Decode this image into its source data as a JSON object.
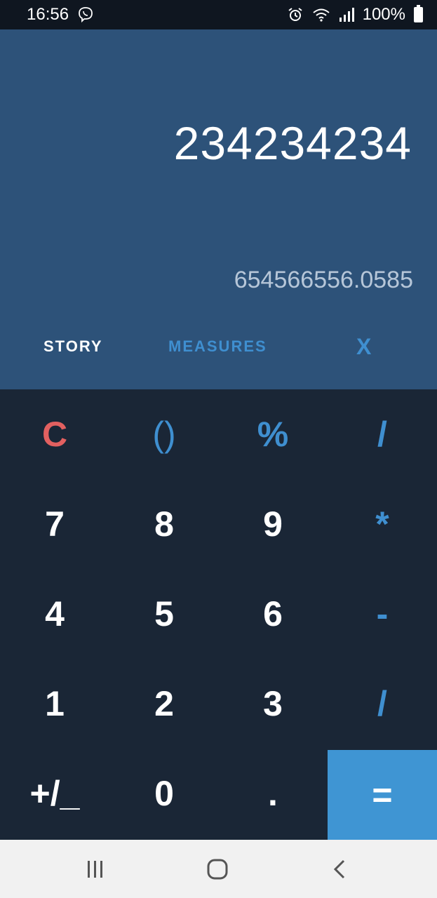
{
  "status_bar": {
    "time": "16:56",
    "battery_text": "100%",
    "icons": [
      "viber-icon",
      "alarm-icon",
      "wifi-icon",
      "signal-icon",
      "battery-icon"
    ]
  },
  "display": {
    "expression": "234234234",
    "result": "654566556.0585"
  },
  "tabs": {
    "story": "STORY",
    "measures": "MEASURES",
    "close": "X"
  },
  "keypad": {
    "row1": [
      "C",
      "()",
      "%",
      "/"
    ],
    "row2": [
      "7",
      "8",
      "9",
      "*"
    ],
    "row3": [
      "4",
      "5",
      "6",
      "-"
    ],
    "row4": [
      "1",
      "2",
      "3",
      "/"
    ],
    "row5": [
      "+/_",
      "0",
      ".",
      "="
    ]
  },
  "colors": {
    "display_bg": "#2d5279",
    "keypad_bg": "#1a2636",
    "accent_blue": "#3f8fd0",
    "clear_red": "#e26060",
    "equals_bg": "#3f95d3"
  },
  "nav_bar": {
    "icons": [
      "recent-apps-icon",
      "home-icon",
      "back-icon"
    ]
  }
}
